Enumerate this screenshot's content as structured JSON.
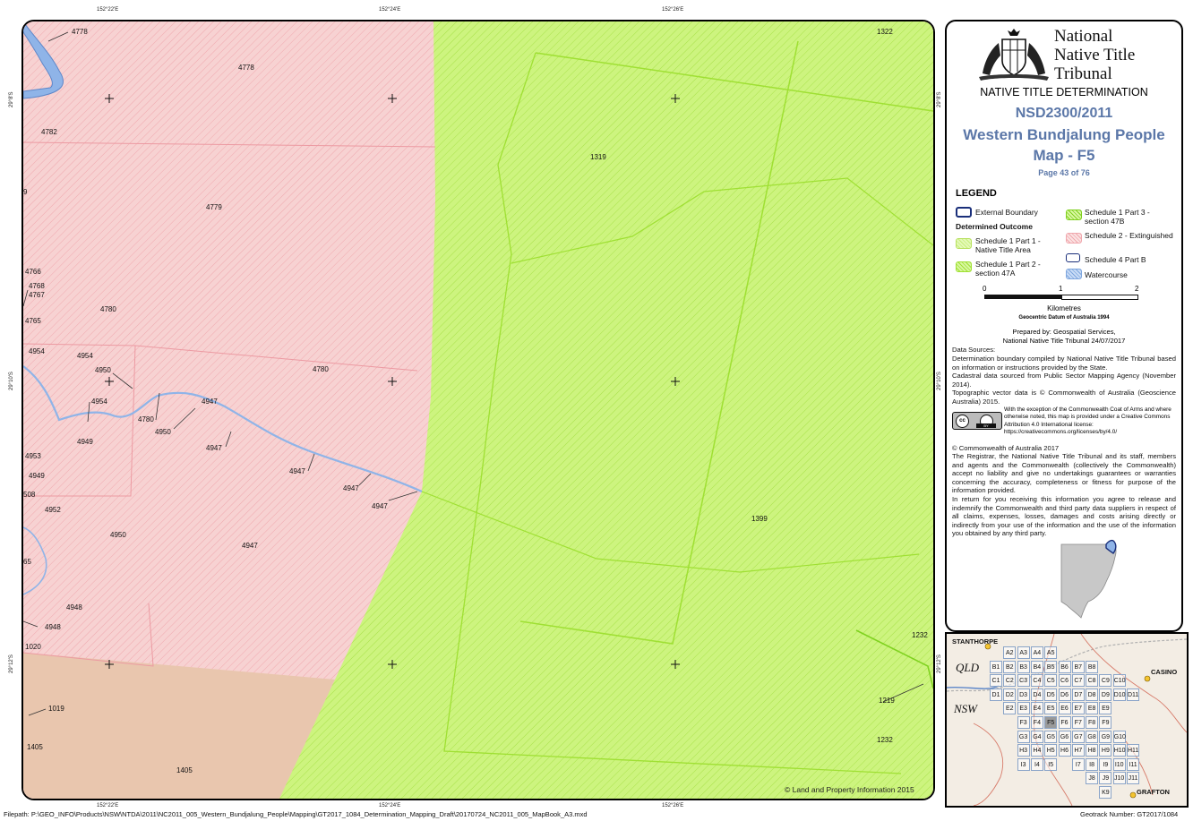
{
  "coords": {
    "top": [
      "152°22'E",
      "152°24'E",
      "152°26'E"
    ],
    "bottom": [
      "152°22'E",
      "152°24'E",
      "152°26'E"
    ],
    "left": [
      "29°8'S",
      "29°10'S",
      "29°12'S"
    ],
    "right": [
      "29°8'S",
      "29°10'S",
      "29°12'S"
    ]
  },
  "map_labels": {
    "l4778a": "4778",
    "l4778b": "4778",
    "l4782": "4782",
    "l9": "9",
    "l4779": "4779",
    "l4766": "4766",
    "l4768": "4768",
    "l4767": "4767",
    "l4765": "4765",
    "l4780a": "4780",
    "l4954a": "4954",
    "l4954b": "4954",
    "l4950a": "4950",
    "l4954c": "4954",
    "l4780b": "4780",
    "l4947a": "4947",
    "l4950b": "4950",
    "l4780c": "4780",
    "l4949a": "4949",
    "l4947b": "4947",
    "l4953": "4953",
    "l4949b": "4949",
    "l508": "508",
    "l4947c": "4947",
    "l4947d": "4947",
    "l4952": "4952",
    "l4947e": "4947",
    "l4950c": "4950",
    "l4947f": "4947",
    "l65": "65",
    "l4948a": "4948",
    "l4948b": "4948",
    "l1020": "1020",
    "l1019": "1019",
    "l1405a": "1405",
    "l1405b": "1405",
    "l1322": "1322",
    "l1319": "1319",
    "l1399": "1399",
    "l1232a": "1232",
    "l1219": "1219",
    "l1232b": "1232"
  },
  "copyright": "© Land and Property Information 2015",
  "panel": {
    "org_line1": "National",
    "org_line2": "Native Title",
    "org_line3": "Tribunal",
    "determination": "NATIVE TITLE DETERMINATION",
    "case_no": "NSD2300/2011",
    "case_name": "Western Bundjalung People",
    "map_id": "Map - F5",
    "page": "Page 43 of 76",
    "legend_title": "LEGEND",
    "legend": {
      "external": "External Boundary",
      "determined": "Determined Outcome",
      "s1p1": "Schedule 1 Part 1 - Native Title Area",
      "s1p2": "Schedule 1 Part 2 - section 47A",
      "s1p3": "Schedule 1 Part 3 - section 47B",
      "s2": "Schedule 2 - Extinguished",
      "s4b": "Schedule 4 Part B",
      "water": "Watercourse"
    },
    "scale": {
      "t0": "0",
      "t1": "1",
      "t2": "2",
      "unit": "Kilometres"
    },
    "datum": "Geocentric Datum of Australia 1994",
    "prepared1": "Prepared by: Geospatial Services,",
    "prepared2": "National Native Title Tribunal  24/07/2017",
    "data_sources": "Data Sources:",
    "src1": "Determination boundary compiled by National Native Title Tribunal based on information or instructions provided by the State.",
    "src2": "Cadastral data sourced from Public Sector Mapping Agency (November 2014).",
    "src3": "Topographic vector data is © Commonwealth of Australia (Geoscience Australia) 2015.",
    "cc_text": "With the exception of the Commonwealth Coat of Arms and where otherwise noted, this map is provided under a Creative Commons Attribution 4.0 International license: https://creativecommons.org/licenses/by/4.0/",
    "cc_badge": "BY",
    "commonwealth": "© Commonwealth of Australia 2017",
    "disclaimer1": "The Registrar, the National Native Title Tribunal and its staff, members and agents and the Commonwealth (collectively the Commonwealth) accept no liability and give no undertakings guarantees or warranties concerning the accuracy, completeness or fitness for purpose of the information provided.",
    "disclaimer2": "In return for you receiving this information you agree to release and indemnify the Commonwealth and third party data suppliers in respect of all claims, expenses, losses, damages and costs arising directly or indirectly from your use of the information and the use of the information you obtained by any third party."
  },
  "inset": {
    "places": {
      "stanthorpe": "STANTHORPE",
      "casino": "CASINO",
      "grafton": "GRAFTON"
    },
    "states": {
      "qld": "QLD",
      "nsw": "NSW"
    },
    "rows": [
      [
        "A2",
        "A3",
        "A4",
        "A5"
      ],
      [
        "B1",
        "B2",
        "B3",
        "B4",
        "B5",
        "B6",
        "B7",
        "B8"
      ],
      [
        "C1",
        "C2",
        "C3",
        "C4",
        "C5",
        "C6",
        "C7",
        "C8",
        "C9",
        "C10"
      ],
      [
        "D1",
        "D2",
        "D3",
        "D4",
        "D5",
        "D6",
        "D7",
        "D8",
        "D9",
        "D10",
        "D11"
      ],
      [
        "E2",
        "E3",
        "E4",
        "E5",
        "E6",
        "E7",
        "E8",
        "E9"
      ],
      [
        "F3",
        "F4",
        "F5",
        "F6",
        "F7",
        "F8",
        "F9"
      ],
      [
        "G3",
        "G4",
        "G5",
        "G6",
        "G7",
        "G8",
        "G9",
        "G10"
      ],
      [
        "H3",
        "H4",
        "H5",
        "H6",
        "H7",
        "H8",
        "H9",
        "H10",
        "H11"
      ],
      [
        "I3",
        "I4",
        "I5",
        "I7",
        "I8",
        "I9",
        "I10",
        "I11"
      ],
      [
        "J8",
        "J9",
        "J10",
        "J11"
      ],
      [
        "K9"
      ]
    ],
    "current": "F5"
  },
  "footer": {
    "filepath": "Filepath: P:\\GEO_INFO\\Products\\NSW\\NTDA\\2011\\NC2011_005_Western_Bundjalung_People\\Mapping\\GT2017_1084_Determination_Mapping_Draft\\20170724_NC2011_005_MapBook_A3.mxd",
    "geotrack": "Geotrack Number: GT2017/1084"
  },
  "colors": {
    "extinguished": "#f7d2d2",
    "native_title": "#cdf47f",
    "brown_area": "#e9c6ae",
    "title_blue": "#5b77a8",
    "water": "#8fb4e8"
  }
}
